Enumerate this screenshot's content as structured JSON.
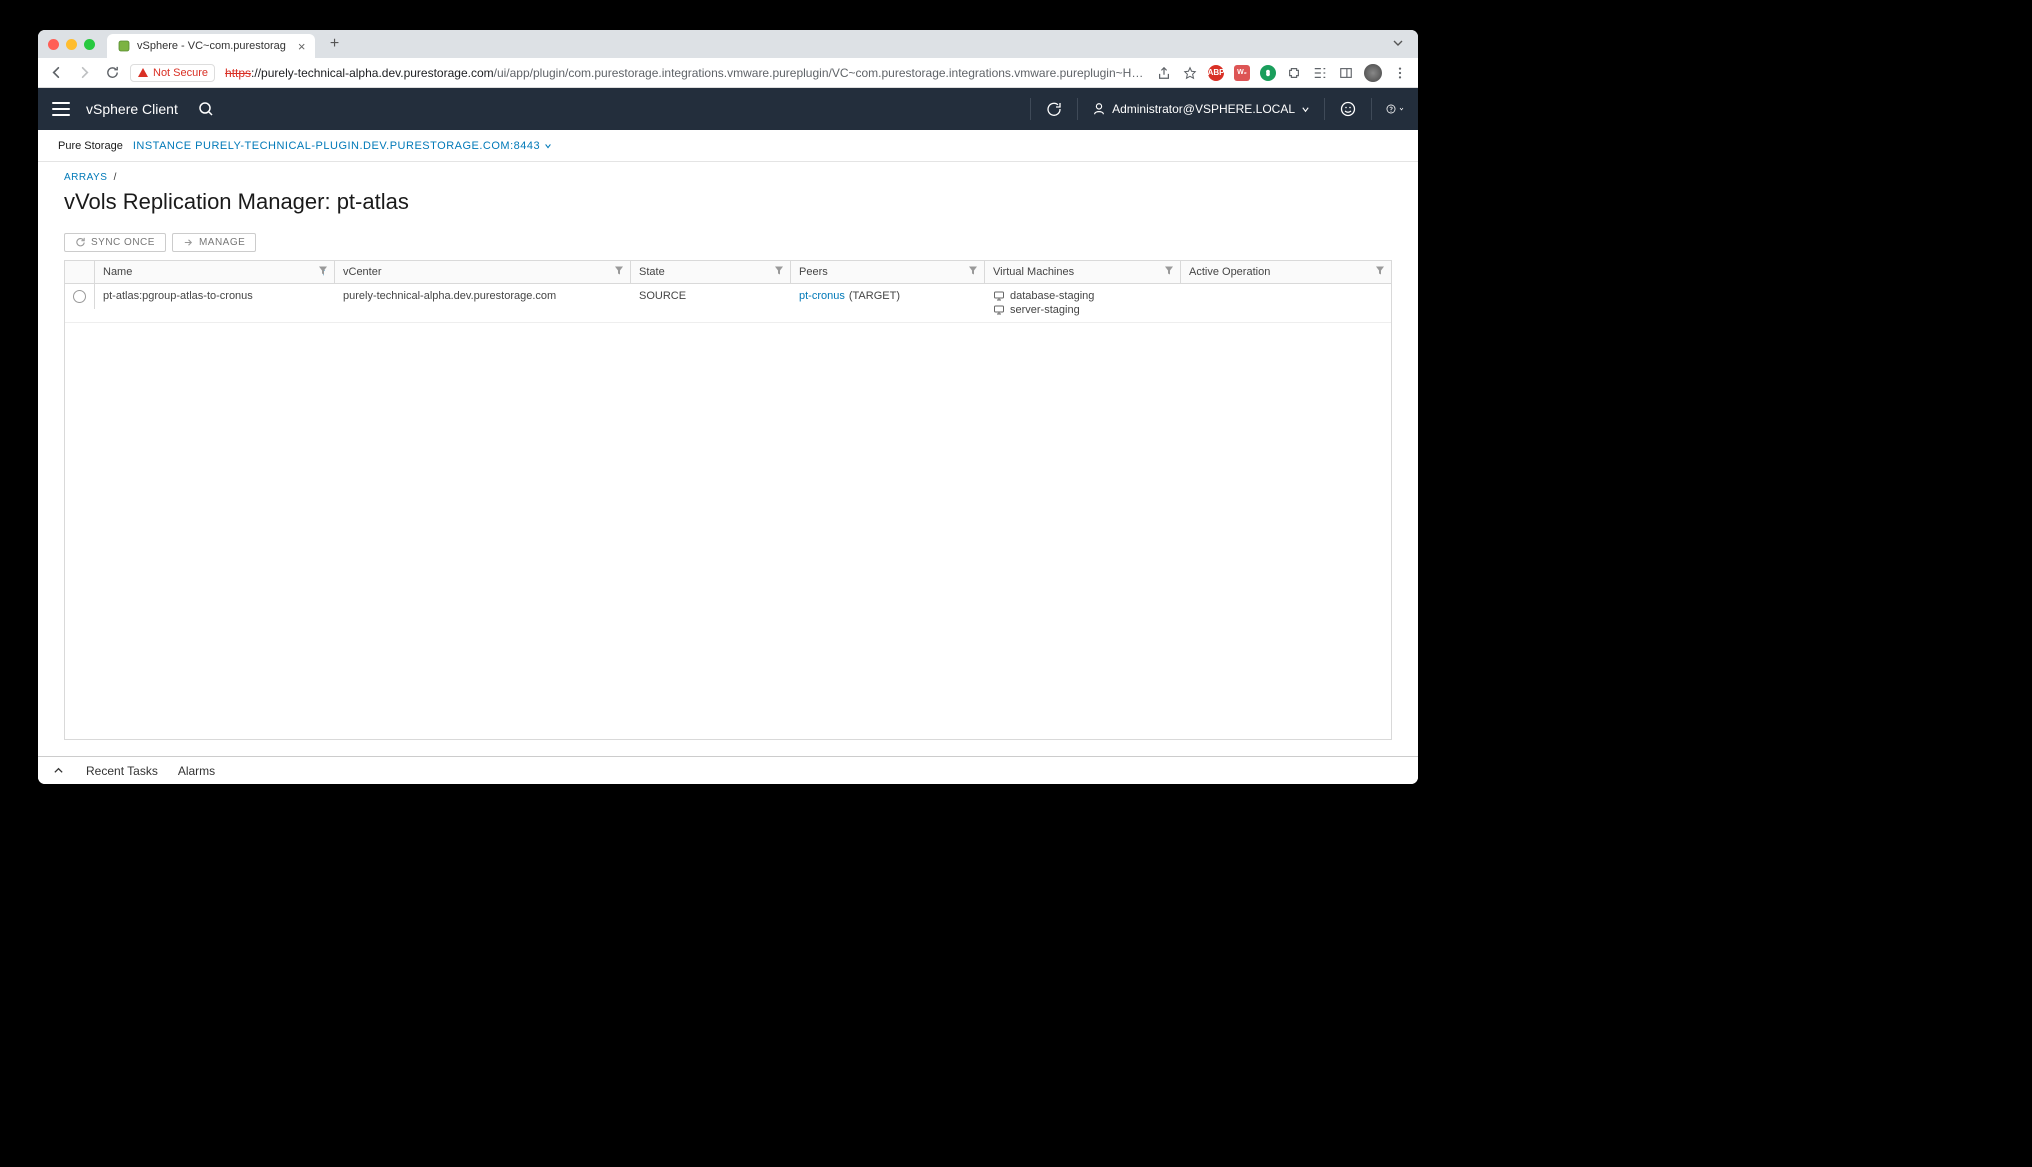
{
  "browser": {
    "tab_title": "vSphere - VC~com.purestorag",
    "security_label": "Not Secure",
    "url_proto": "https",
    "url_host": "://purely-technical-alpha.dev.purestorage.com",
    "url_path": "/ui/app/plugin/com.purestorage.integrations.vmware.pureplugin/VC~com.purestorage.integrations.vmware.pureplugin~HOME_VIEW~~HOME_VIEW?rp..."
  },
  "header": {
    "app_title": "vSphere Client",
    "user": "Administrator@VSPHERE.LOCAL"
  },
  "sub_header": {
    "label": "Pure Storage",
    "instance": "INSTANCE PURELY-TECHNICAL-PLUGIN.DEV.PURESTORAGE.COM:8443"
  },
  "breadcrumb": {
    "root": "ARRAYS"
  },
  "page_title": "vVols Replication Manager: pt-atlas",
  "actions": {
    "sync": "SYNC ONCE",
    "manage": "MANAGE"
  },
  "table": {
    "columns": {
      "name": "Name",
      "vcenter": "vCenter",
      "state": "State",
      "peers": "Peers",
      "vms": "Virtual Machines",
      "op": "Active Operation"
    },
    "rows": [
      {
        "name": "pt-atlas:pgroup-atlas-to-cronus",
        "vcenter": "purely-technical-alpha.dev.purestorage.com",
        "state": "SOURCE",
        "peer_link": "pt-cronus",
        "peer_suffix": "(TARGET)",
        "vms": [
          "database-staging",
          "server-staging"
        ],
        "op": ""
      }
    ]
  },
  "footer": {
    "tasks": "Recent Tasks",
    "alarms": "Alarms"
  }
}
